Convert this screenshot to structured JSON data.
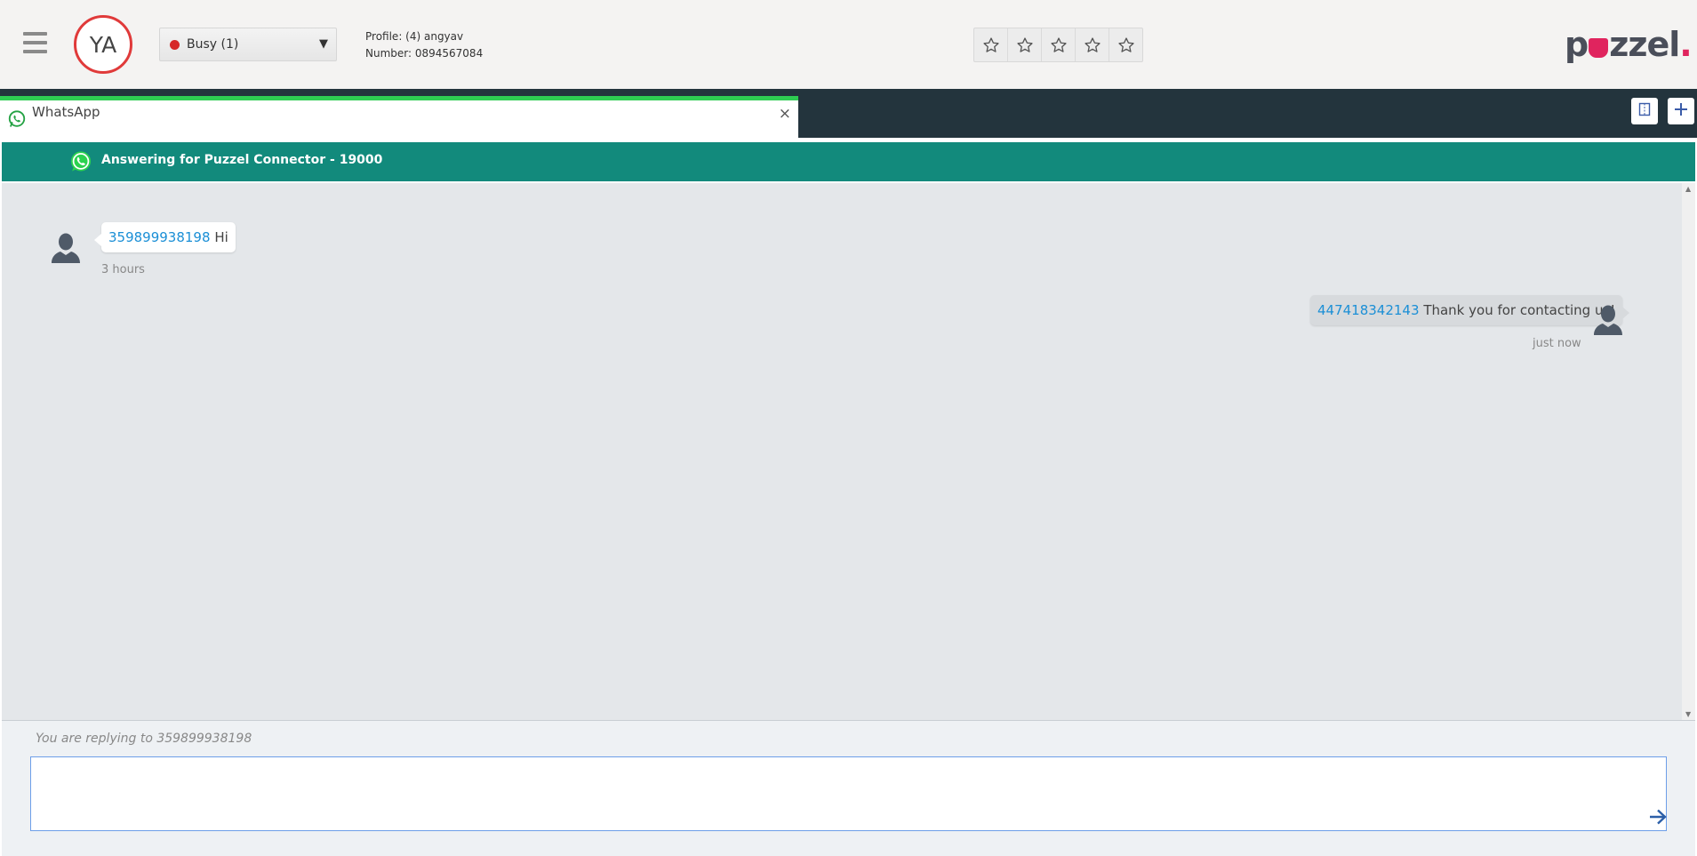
{
  "header": {
    "avatar_initials": "YA",
    "status": {
      "label": "Busy (1)",
      "color": "#d62828"
    },
    "profile_line": "Profile: (4) angyav",
    "number_line": "Number: 0894567084",
    "rating": {
      "stars": 5,
      "filled": 0
    },
    "logo": {
      "before": "p",
      "after": "zzel",
      "dot": "."
    }
  },
  "tab": {
    "title": "WhatsApp",
    "close_label": "×"
  },
  "banner": {
    "text": "Answering for Puzzel Connector - 19000"
  },
  "messages": [
    {
      "sender": "359899938198",
      "text": "Hi",
      "time": "3 hours",
      "side": "left"
    },
    {
      "sender": "447418342143",
      "text": "Thank you for contacting us!",
      "time": "just now",
      "side": "right"
    }
  ],
  "reply": {
    "hint": "You are replying to 359899938198",
    "value": ""
  },
  "colors": {
    "accent_green": "#2ecc52",
    "banner_teal": "#128a7c",
    "link_blue": "#1b8fd6",
    "status_red": "#d62828",
    "logo_pink": "#e0245e"
  },
  "icons": [
    "hamburger-icon",
    "whatsapp-icon",
    "close-icon",
    "split-view-icon",
    "plus-icon",
    "star-icon",
    "person-icon",
    "send-arrow-icon"
  ]
}
